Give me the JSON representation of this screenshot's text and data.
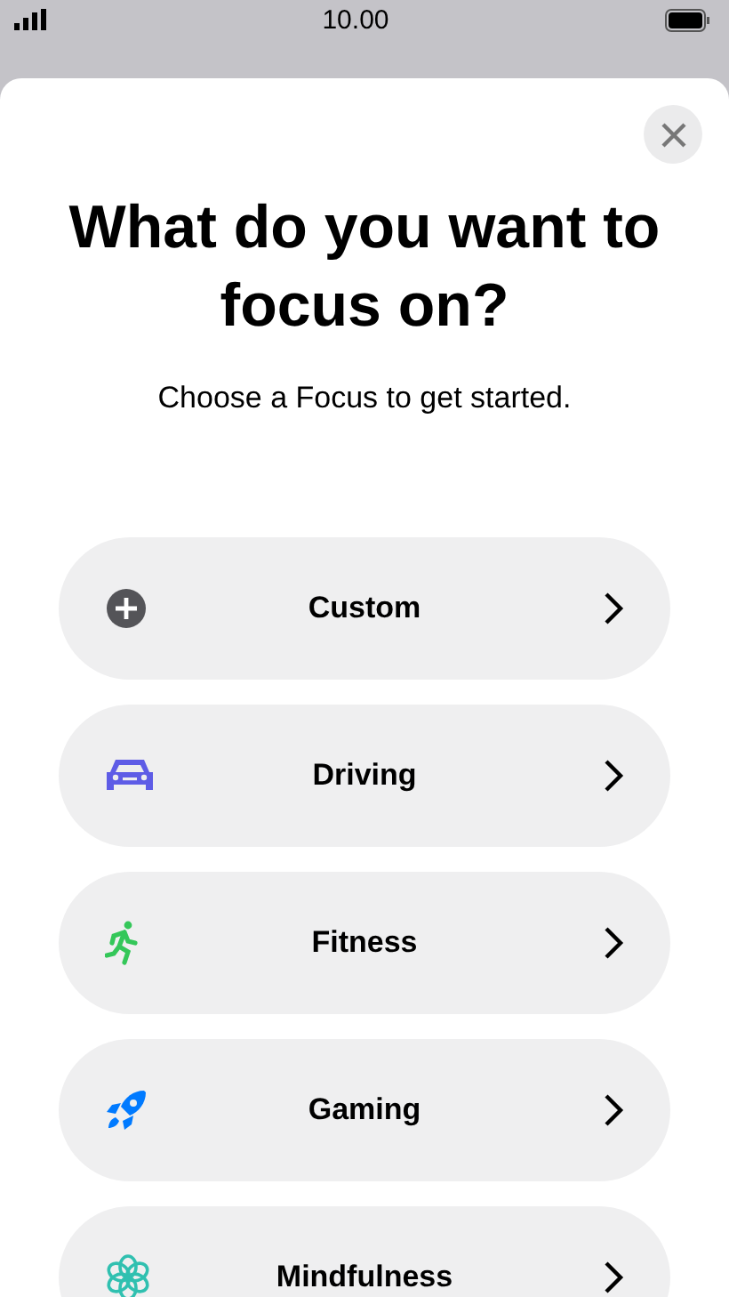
{
  "status_bar": {
    "time": "10.00"
  },
  "sheet": {
    "title": "What do you want to focus on?",
    "subtitle": "Choose a Focus to get started.",
    "options": [
      {
        "label": "Custom",
        "kind": "custom",
        "color": "#545458"
      },
      {
        "label": "Driving",
        "kind": "driving",
        "color": "#5e5ce6"
      },
      {
        "label": "Fitness",
        "kind": "fitness",
        "color": "#34c759"
      },
      {
        "label": "Gaming",
        "kind": "gaming",
        "color": "#007aff"
      },
      {
        "label": "Mindfulness",
        "kind": "mindfulness",
        "color": "#30c0b0"
      }
    ]
  }
}
